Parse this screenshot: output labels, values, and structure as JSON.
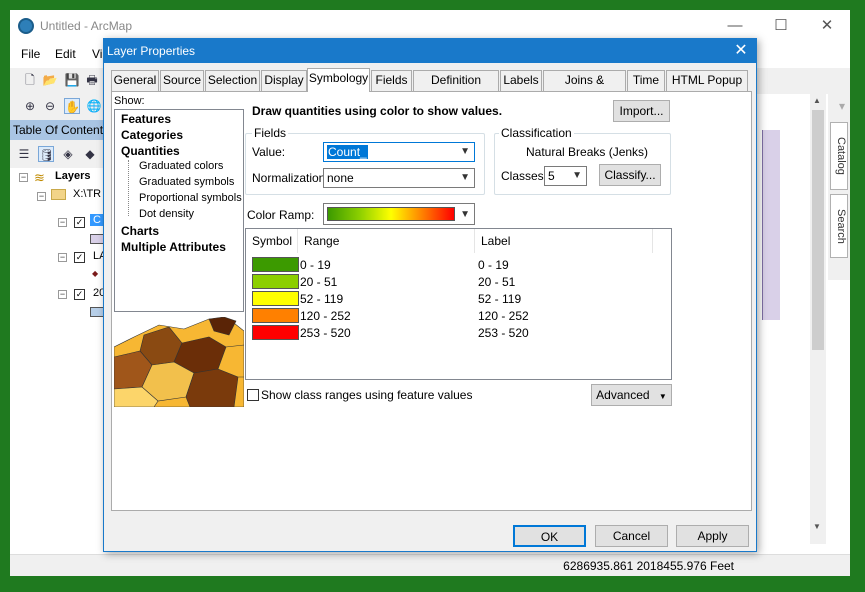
{
  "arcmap": {
    "title": "Untitled - ArcMap",
    "window_buttons": [
      "—",
      "☐",
      "✕"
    ],
    "menu": [
      "File",
      "Edit",
      "Vi"
    ],
    "toc": {
      "title": "Table Of Contents",
      "root": "Layers",
      "items": [
        {
          "label": "X:\\TR"
        },
        {
          "label": "C"
        },
        {
          "label": "LA"
        },
        {
          "label": "20"
        }
      ]
    },
    "side_tabs": [
      "Catalog",
      "Search"
    ],
    "coordinates": "6286935.861  2018455.976 Feet"
  },
  "dialog": {
    "title": "Layer Properties",
    "tabs": [
      "General",
      "Source",
      "Selection",
      "Display",
      "Symbology",
      "Fields",
      "Definition Query",
      "Labels",
      "Joins & Relates",
      "Time",
      "HTML Popup"
    ],
    "active_tab": "Symbology",
    "show": {
      "label": "Show:",
      "items": [
        {
          "label": "Features",
          "level": 0
        },
        {
          "label": "Categories",
          "level": 0
        },
        {
          "label": "Quantities",
          "level": 0
        },
        {
          "label": "Graduated colors",
          "level": 1
        },
        {
          "label": "Graduated symbols",
          "level": 1
        },
        {
          "label": "Proportional symbols",
          "level": 1
        },
        {
          "label": "Dot density",
          "level": 1
        },
        {
          "label": "Charts",
          "level": 0
        },
        {
          "label": "Multiple Attributes",
          "level": 0
        }
      ]
    },
    "description": "Draw quantities using color to show values.",
    "import_button": "Import...",
    "fields": {
      "title": "Fields",
      "value_label": "Value:",
      "value": "Count_",
      "normalization_label": "Normalization:",
      "normalization": "none"
    },
    "classification": {
      "title": "Classification",
      "method": "Natural Breaks (Jenks)",
      "classes_label": "Classes:",
      "classes": "5",
      "classify_button": "Classify..."
    },
    "color_ramp_label": "Color Ramp:",
    "table": {
      "headers": [
        "Symbol",
        "Range",
        "Label"
      ],
      "rows": [
        {
          "color": "#3c9a00",
          "range": "0 - 19",
          "label": "0 - 19"
        },
        {
          "color": "#8ccf00",
          "range": "20 - 51",
          "label": "20 - 51"
        },
        {
          "color": "#ffff00",
          "range": "52 - 119",
          "label": "52 - 119"
        },
        {
          "color": "#ff8000",
          "range": "120 - 252",
          "label": "120 - 252"
        },
        {
          "color": "#ff0000",
          "range": "253 - 520",
          "label": "253 - 520"
        }
      ]
    },
    "show_class_ranges_label": "Show class ranges using feature values",
    "advanced_button": "Advanced",
    "footer": {
      "ok": "OK",
      "cancel": "Cancel",
      "apply": "Apply"
    }
  }
}
